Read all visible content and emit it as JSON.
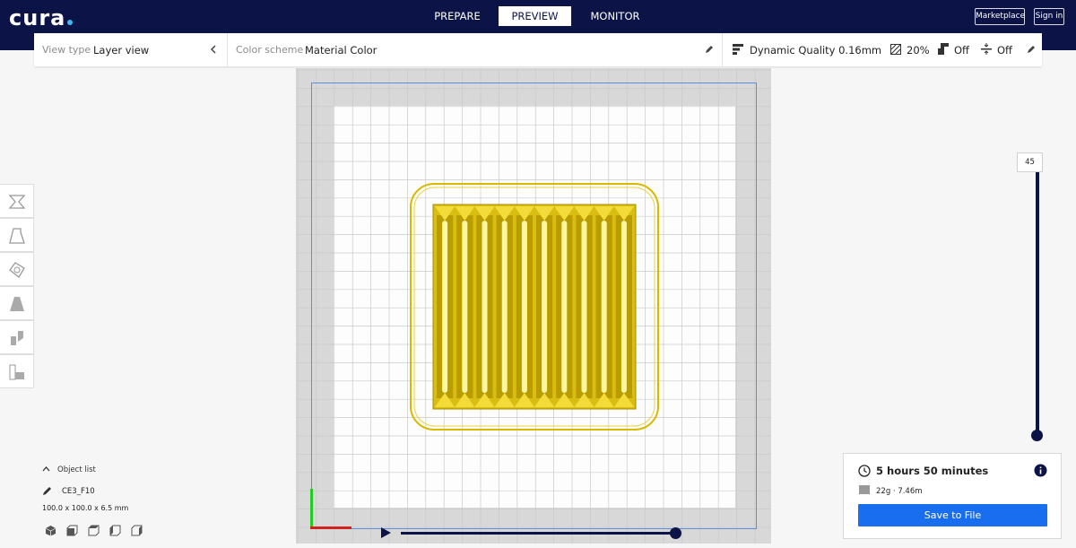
{
  "app": {
    "logo_text": "cura",
    "accent_color": "#196ef0",
    "header_color": "#0c1447"
  },
  "header": {
    "tabs": [
      {
        "label": "PREPARE",
        "active": false
      },
      {
        "label": "PREVIEW",
        "active": true
      },
      {
        "label": "MONITOR",
        "active": false
      }
    ],
    "marketplace_label": "Marketplace",
    "signin_label": "Sign in"
  },
  "toolbar": {
    "view_type_label": "View type",
    "view_type_value": "Layer view",
    "color_scheme_label": "Color scheme",
    "color_scheme_value": "Material Color",
    "profile": "Dynamic Quality 0.16mm",
    "infill": "20%",
    "support": "Off",
    "adhesion": "Off",
    "icons": [
      "chevron-left-icon",
      "pencil-icon",
      "profile-icon",
      "infill-icon",
      "support-icon",
      "adhesion-icon"
    ]
  },
  "layer_slider": {
    "current_layer": "45",
    "fraction": 1.0
  },
  "path_slider": {
    "fraction": 1.0
  },
  "side_tools": [
    "move-tool-icon",
    "scale-tool-icon",
    "rotate-tool-icon",
    "mirror-tool-icon",
    "per-model-settings-icon",
    "support-blocker-icon"
  ],
  "object_list": {
    "toggle_label": "Object list",
    "object_name": "CE3_F10",
    "dimensions": "100.0 x 100.0 x 6.5 mm",
    "view_icons": [
      "3d-view-icon",
      "front-view-icon",
      "top-view-icon",
      "left-view-icon",
      "right-view-icon"
    ]
  },
  "print_info": {
    "time": "5 hours 50 minutes",
    "material": "22g · 7.46m",
    "save_label": "Save to File"
  }
}
